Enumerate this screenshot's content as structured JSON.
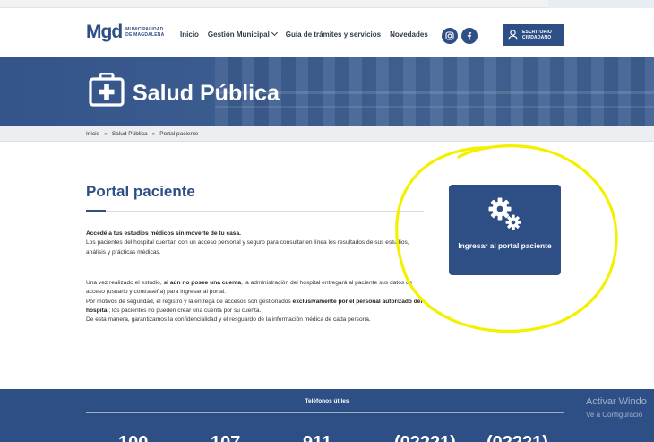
{
  "brand": {
    "logo_mark": "Mgd",
    "logo_text_line1": "MUNICIPALIDAD",
    "logo_text_line2": "DE MAGDALENA"
  },
  "nav": {
    "items": [
      {
        "label": "Inicio"
      },
      {
        "label": "Gestión Municipal"
      },
      {
        "label": "Guía de trámites y servicios"
      },
      {
        "label": "Novedades"
      }
    ],
    "escritorio_line1": "ESCRITORIO",
    "escritorio_line2": "CIUDADANO"
  },
  "banner": {
    "title": "Salud Pública"
  },
  "breadcrumb": {
    "items": [
      "Inicio",
      "Salud Pública",
      "Portal paciente"
    ],
    "separator": "»"
  },
  "content": {
    "title": "Portal paciente",
    "p1_bold": "Accedé a tus estudios médicos sin moverte de tu casa.",
    "p1_text": "Los pacientes del hospital cuentan con un acceso personal y seguro para consultar en línea los resultados de sus estudios, análisis y prácticas médicas.",
    "p2_a": "Una vez realizado el estudio, ",
    "p2_b": "si aún no posee una cuenta",
    "p2_c": ", la administración del hospital entregará al paciente sus datos de acceso (usuario y contraseña) para ingresar al portal.",
    "p3_a": "Por motivos de seguridad, el registro y la entrega de accesos son gestionados ",
    "p3_b": "exclusivamente por el personal autorizado del hospital",
    "p3_c": "; los pacientes no pueden crear una cuenta por su cuenta.",
    "p4": "De esta manera, garantizamos la confidencialidad y el resguardo de la información médica de cada persona."
  },
  "portal_card": {
    "label": "Ingresar al portal paciente"
  },
  "footer": {
    "title": "Teléfonos útiles",
    "phones_partial": [
      "100",
      "107",
      "911",
      "(02221)",
      "(02221)"
    ]
  },
  "watermark": {
    "line1": "Activar Windo",
    "line2": "Ve a Configuració"
  },
  "colors": {
    "brand_blue": "#2e4f86",
    "marker_yellow": "#f4f000"
  },
  "icons": {
    "banner": "first-aid-kit-icon",
    "card": "gears-icon",
    "instagram": "instagram-icon",
    "facebook": "facebook-icon",
    "user": "user-icon"
  }
}
